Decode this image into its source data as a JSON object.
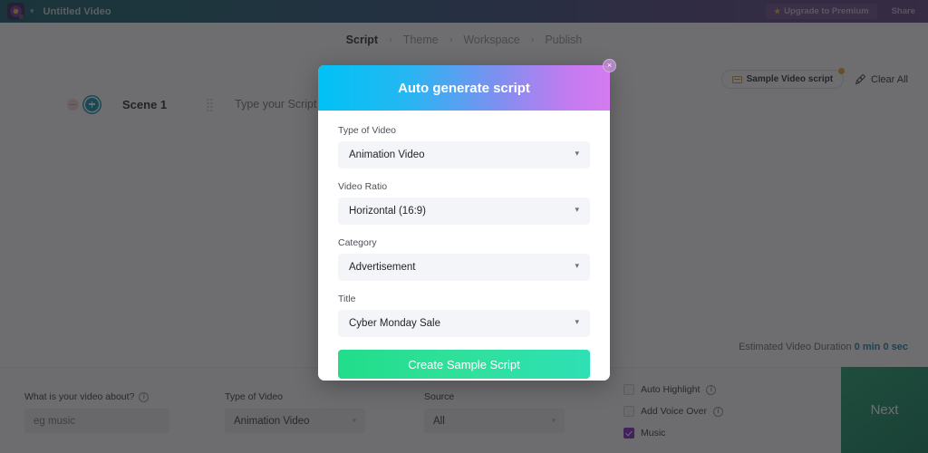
{
  "topbar": {
    "logo_name": "app-logo",
    "doc_title": "Untitled Video",
    "upgrade_label": "Upgrade to Premium",
    "share_label": "Share"
  },
  "breadcrumb": {
    "separator": "›",
    "steps": [
      {
        "label": "Script",
        "active": true
      },
      {
        "label": "Theme",
        "active": false
      },
      {
        "label": "Workspace",
        "active": false
      },
      {
        "label": "Publish",
        "active": false
      }
    ]
  },
  "script_area": {
    "sample_button_label": "Sample Video script",
    "clear_all_label": "Clear All",
    "scene_label": "Scene 1",
    "script_placeholder": "Type your Script here",
    "duration_prefix": "Estimated Video Duration",
    "duration_value": "0 min 0 sec"
  },
  "bottombar": {
    "about_label": "What is your video about?",
    "about_placeholder": "eg music",
    "type_label": "Type of Video",
    "type_value": "Animation Video",
    "source_label": "Source",
    "source_value": "All",
    "checkboxes": [
      {
        "label": "Auto Highlight",
        "checked": false,
        "info": true
      },
      {
        "label": "Add Voice Over",
        "checked": false,
        "info": true
      },
      {
        "label": "Music",
        "checked": true,
        "info": false
      }
    ],
    "next_label": "Next"
  },
  "modal": {
    "title": "Auto generate script",
    "close_glyph": "×",
    "caret_glyph": "▾",
    "fields": [
      {
        "label": "Type of Video",
        "value": "Animation Video"
      },
      {
        "label": "Video Ratio",
        "value": "Horizontal (16:9)"
      },
      {
        "label": "Category",
        "value": "Advertisement"
      },
      {
        "label": "Title",
        "value": "Cyber Monday Sale"
      }
    ],
    "submit_label": "Create Sample Script"
  },
  "colors": {
    "modal_gradient_start": "#00c2f5",
    "modal_gradient_end": "#d47bef",
    "submit_gradient_start": "#21dd8a",
    "submit_gradient_end": "#2ee0b4",
    "next_button": "#0f8a5f",
    "duration_value": "#0b7e9e",
    "music_checkbox": "#7b22c4",
    "badge_dot": "#f0a020"
  }
}
